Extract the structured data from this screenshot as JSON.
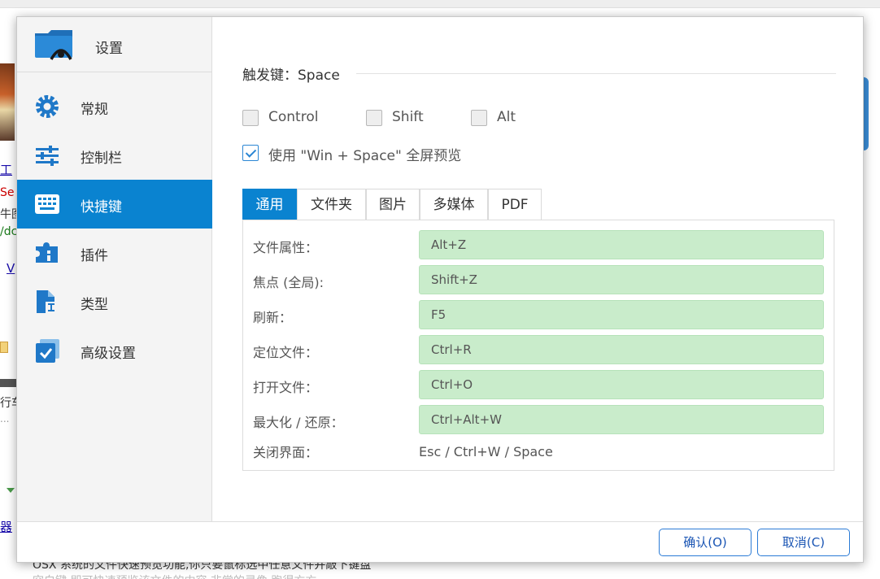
{
  "background": {
    "left_fragments": [
      "工",
      "Se",
      "牛图",
      "/dc",
      "V",
      "行车",
      "...",
      "器"
    ],
    "bottom_line": "OSX 系统的文件快速预览功能,你只要鼠标选中任意文件并敲下键盘",
    "bottom_line2": "空白键,即可快速预览该文件的内容,非常的灵像,跑得方方"
  },
  "sidebar": {
    "title": "设置",
    "items": [
      {
        "label": "常规",
        "icon": "gear-icon"
      },
      {
        "label": "控制栏",
        "icon": "sliders-icon"
      },
      {
        "label": "快捷键",
        "icon": "keyboard-icon"
      },
      {
        "label": "插件",
        "icon": "plugin-icon"
      },
      {
        "label": "类型",
        "icon": "file-type-icon"
      },
      {
        "label": "高级设置",
        "icon": "checkbox-settings-icon"
      }
    ],
    "active_index": 2
  },
  "trigger": {
    "label": "触发键：Space"
  },
  "modifiers": [
    {
      "label": "Control",
      "checked": false
    },
    {
      "label": "Shift",
      "checked": false
    },
    {
      "label": "Alt",
      "checked": false
    }
  ],
  "fullscreen_option": {
    "label": "使用 \"Win + Space\" 全屏预览",
    "checked": true
  },
  "tabs": [
    "通用",
    "文件夹",
    "图片",
    "多媒体",
    "PDF"
  ],
  "active_tab": 0,
  "shortcuts": [
    {
      "label": "文件属性：",
      "value": "Alt+Z",
      "editable": true
    },
    {
      "label": "焦点 (全局):",
      "value": "Shift+Z",
      "editable": true
    },
    {
      "label": "刷新：",
      "value": "F5",
      "editable": true
    },
    {
      "label": "定位文件：",
      "value": "Ctrl+R",
      "editable": true
    },
    {
      "label": "打开文件：",
      "value": "Ctrl+O",
      "editable": true
    },
    {
      "label": "最大化 / 还原：",
      "value": "Ctrl+Alt+W",
      "editable": true
    },
    {
      "label": "关闭界面：",
      "value": "Esc / Ctrl+W / Space",
      "editable": false
    }
  ],
  "footer": {
    "confirm_label": "确认(O)",
    "cancel_label": "取消(C)"
  },
  "colors": {
    "accent": "#0a83d0",
    "shortcut_bg": "#c9eccb",
    "button_border": "#2b7bd6"
  }
}
